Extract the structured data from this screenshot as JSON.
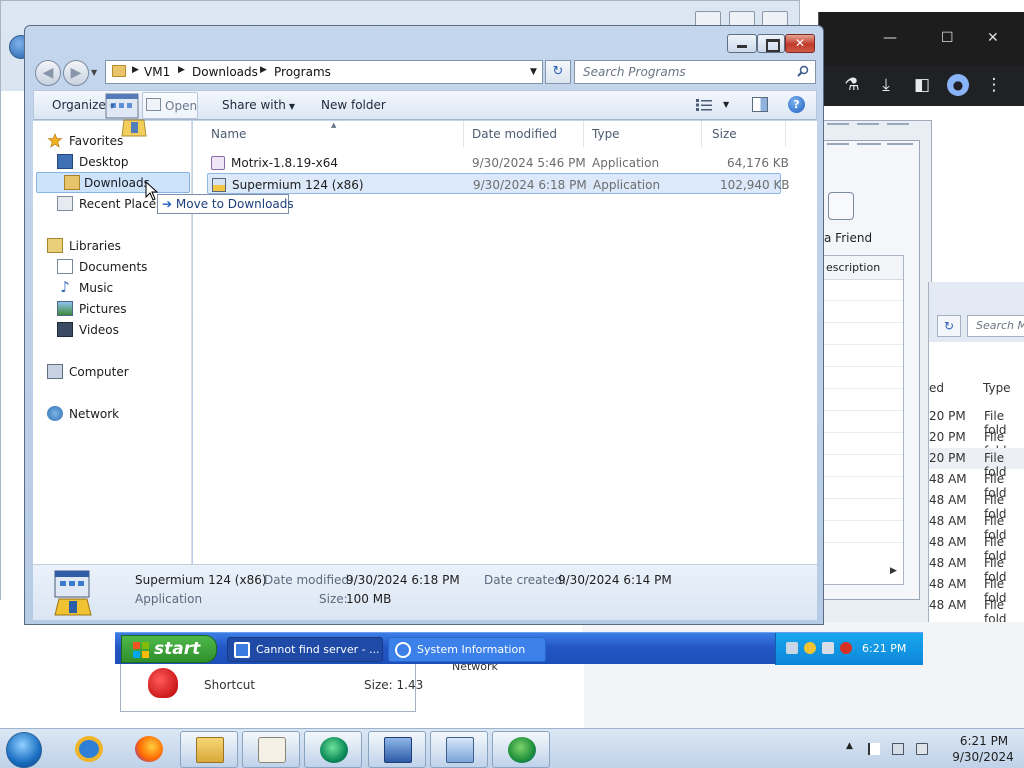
{
  "explorer": {
    "breadcrumb": [
      "VM1",
      "Downloads",
      "Programs"
    ],
    "search_placeholder": "Search Programs",
    "commands": {
      "organize": "Organize",
      "open": "Open",
      "share_with": "Share with",
      "new_folder": "New folder"
    },
    "nav": {
      "favorites": "Favorites",
      "desktop": "Desktop",
      "downloads": "Downloads",
      "recent_places": "Recent Places",
      "libraries": "Libraries",
      "documents": "Documents",
      "music": "Music",
      "pictures": "Pictures",
      "videos": "Videos",
      "computer": "Computer",
      "network": "Network"
    },
    "columns": {
      "name": "Name",
      "date": "Date modified",
      "type": "Type",
      "size": "Size"
    },
    "files": [
      {
        "name": "Motrix-1.8.19-x64",
        "date": "9/30/2024 5:46 PM",
        "type": "Application",
        "size": "64,176 KB"
      },
      {
        "name": "Supermium 124 (x86)",
        "date": "9/30/2024 6:18 PM",
        "type": "Application",
        "size": "102,940 KB"
      }
    ],
    "drag_tooltip": "Move to Downloads",
    "details": {
      "name": "Supermium 124 (x86)",
      "type": "Application",
      "date_modified_label": "Date modified:",
      "date_modified": "9/30/2024 6:18 PM",
      "date_created_label": "Date created:",
      "date_created": "9/30/2024 6:14 PM",
      "size_label": "Size:",
      "size": "100 MB"
    }
  },
  "background": {
    "like_label": "a Friend",
    "desc_header": "escription",
    "right_search": "Search M",
    "right_col_date": "ed",
    "right_col_type": "Type",
    "right_rows": [
      {
        "time": "20 PM",
        "type": "File fold"
      },
      {
        "time": "20 PM",
        "type": "File fold"
      },
      {
        "time": "20 PM",
        "type": "File fold"
      },
      {
        "time": "48 AM",
        "type": "File fold"
      },
      {
        "time": "48 AM",
        "type": "File fold"
      },
      {
        "time": "48 AM",
        "type": "File fold"
      },
      {
        "time": "48 AM",
        "type": "File fold"
      },
      {
        "time": "48 AM",
        "type": "File fold"
      },
      {
        "time": "48 AM",
        "type": "File fold"
      },
      {
        "time": "48 AM",
        "type": "File fold"
      }
    ],
    "shortcut_label": "Shortcut",
    "shortcut_size": "Size: 1.43",
    "network_frag": "Network"
  },
  "xp_taskbar": {
    "start": "start",
    "tasks": [
      "Cannot find server - ...",
      "System Information"
    ],
    "clock": "6:21 PM"
  },
  "win7_taskbar": {
    "time": "6:21 PM",
    "date": "9/30/2024"
  },
  "colors": {
    "xp_taskbar": "#2457c6",
    "xp_start": "#3a9e36",
    "selection": "#dbe9fa",
    "close_button": "#c0392b"
  }
}
